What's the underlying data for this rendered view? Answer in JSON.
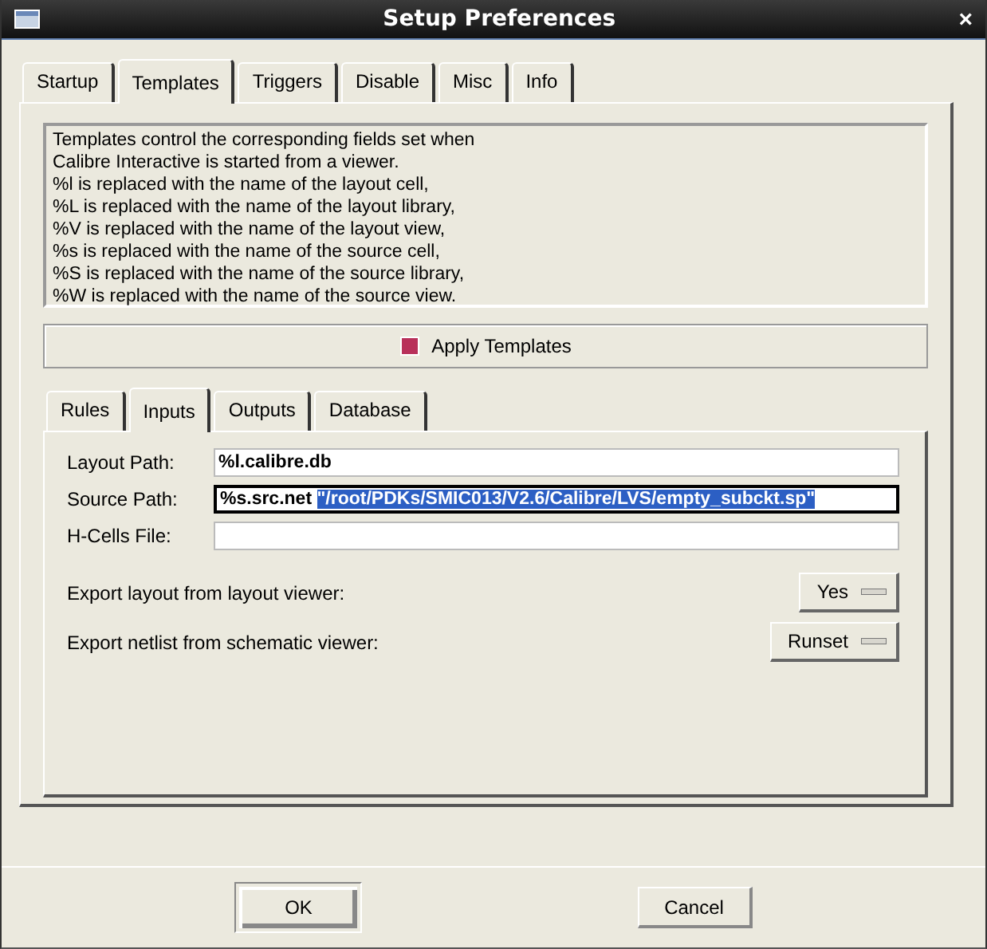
{
  "window": {
    "title": "Setup Preferences",
    "close": "×"
  },
  "tabs": [
    {
      "label": "Startup",
      "selected": false
    },
    {
      "label": "Templates",
      "selected": true
    },
    {
      "label": "Triggers",
      "selected": false
    },
    {
      "label": "Disable",
      "selected": false
    },
    {
      "label": "Misc",
      "selected": false
    },
    {
      "label": "Info",
      "selected": false
    }
  ],
  "description": [
    "Templates control the corresponding fields set when",
    "Calibre Interactive is started from a viewer.",
    "%l is replaced with the name of the layout cell,",
    "%L is replaced with the name of the layout library,",
    "%V is replaced with the name of the layout view,",
    "%s is replaced with the name of the source cell,",
    "%S is replaced with the name of the source library,",
    "%W is replaced with the name of the source view."
  ],
  "apply_templates": {
    "label": "Apply Templates",
    "checked": true
  },
  "subtabs": [
    {
      "label": "Rules",
      "selected": false
    },
    {
      "label": "Inputs",
      "selected": true
    },
    {
      "label": "Outputs",
      "selected": false
    },
    {
      "label": "Database",
      "selected": false
    }
  ],
  "fields": [
    {
      "label": "Layout Path:",
      "value": "%l.calibre.db",
      "focused": false
    },
    {
      "label": "Source Path:",
      "value": "%s.src.net ",
      "selected_text": "\"/root/PDKs/SMIC013/V2.6/Calibre/LVS/empty_subckt.sp\"",
      "focused": true
    },
    {
      "label": "H-Cells File:",
      "focused": false
    }
  ],
  "options": [
    {
      "label": "Export layout from layout viewer:",
      "value": "Yes"
    },
    {
      "label": "Export netlist from schematic viewer:",
      "value": "Runset"
    }
  ],
  "buttons": [
    {
      "label": "OK",
      "default": true
    },
    {
      "label": "Cancel",
      "default": false
    }
  ]
}
